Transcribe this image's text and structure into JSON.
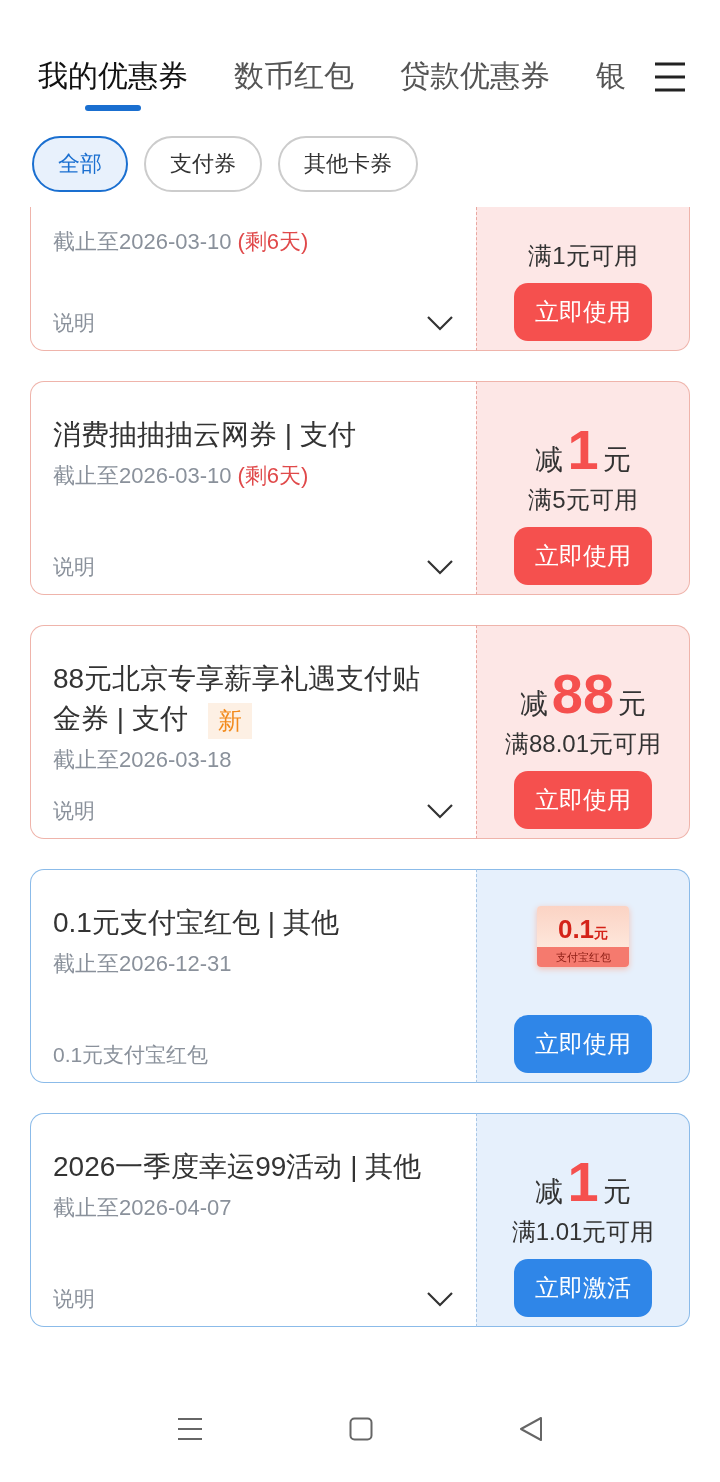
{
  "tabs": [
    {
      "label": "我的优惠券",
      "selected": true
    },
    {
      "label": "数币红包",
      "selected": false
    },
    {
      "label": "贷款优惠券",
      "selected": false
    },
    {
      "label": "银",
      "selected": false
    }
  ],
  "filters": [
    {
      "label": "全部",
      "selected": true
    },
    {
      "label": "支付券",
      "selected": false
    },
    {
      "label": "其他卡券",
      "selected": false
    }
  ],
  "coupons": [
    {
      "kind": "pay",
      "cut": true,
      "expiry": "截止至2026-03-10",
      "remaining": "(剩6天)",
      "note": "说明",
      "expandable": true,
      "minimum": "满1元可用",
      "button": "立即使用"
    },
    {
      "kind": "pay",
      "cut": false,
      "title": "消费抽抽抽云网券 | 支付",
      "expiry": "截止至2026-03-10",
      "remaining": "(剩6天)",
      "note": "说明",
      "expandable": true,
      "discount": {
        "prefix": "减",
        "amount": "1",
        "unit": "元"
      },
      "minimum": "满5元可用",
      "button": "立即使用"
    },
    {
      "kind": "pay",
      "cut": false,
      "title": "88元北京专享薪享礼遇支付贴金券 | 支付",
      "badge": "新",
      "expiry": "截止至2026-03-18",
      "note": "说明",
      "expandable": true,
      "discount": {
        "prefix": "减",
        "amount": "88",
        "unit": "元"
      },
      "minimum": "满88.01元可用",
      "button": "立即使用"
    },
    {
      "kind": "other",
      "cut": false,
      "title": "0.1元支付宝红包 |  其他",
      "expiry": "截止至2026-12-31",
      "note": "0.1元支付宝红包",
      "expandable": false,
      "voucher": {
        "amount": "0.1",
        "unit": "元",
        "label": "支付宝红包"
      },
      "button": "立即使用"
    },
    {
      "kind": "other",
      "cut": false,
      "title": "2026一季度幸运99活动 | 其他",
      "expiry": "截止至2026-04-07",
      "note": "说明",
      "expandable": true,
      "discount": {
        "prefix": "减",
        "amount": "1",
        "unit": "元"
      },
      "minimum": "满1.01元可用",
      "button": "立即激活"
    }
  ]
}
